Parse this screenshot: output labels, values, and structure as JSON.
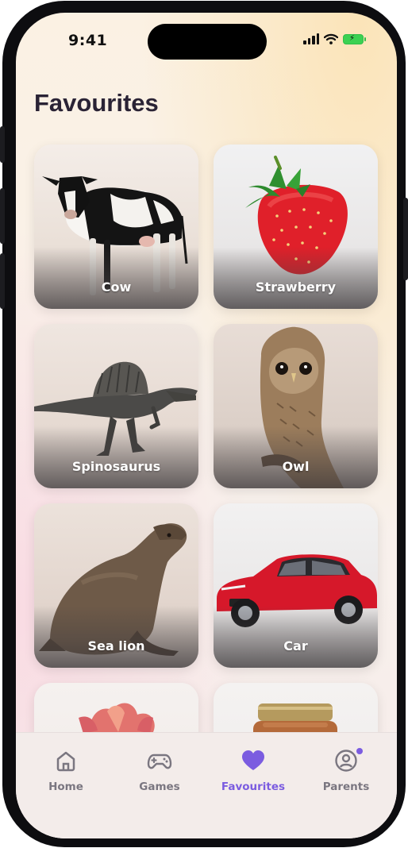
{
  "status_bar": {
    "time": "9:41"
  },
  "header": {
    "title": "Favourites"
  },
  "cards": [
    {
      "label": "Cow"
    },
    {
      "label": "Strawberry"
    },
    {
      "label": "Spinosaurus"
    },
    {
      "label": "Owl"
    },
    {
      "label": "Sea lion"
    },
    {
      "label": "Car"
    },
    {
      "label": ""
    },
    {
      "label": ""
    }
  ],
  "nav": {
    "items": [
      {
        "label": "Home",
        "icon": "home-icon",
        "active": false
      },
      {
        "label": "Games",
        "icon": "gamepad-icon",
        "active": false
      },
      {
        "label": "Favourites",
        "icon": "heart-icon",
        "active": true
      },
      {
        "label": "Parents",
        "icon": "user-circle-icon",
        "active": false
      }
    ]
  },
  "colors": {
    "accent": "#7b5ce0",
    "title": "#2a2335",
    "inactive_nav": "#7a7680"
  }
}
